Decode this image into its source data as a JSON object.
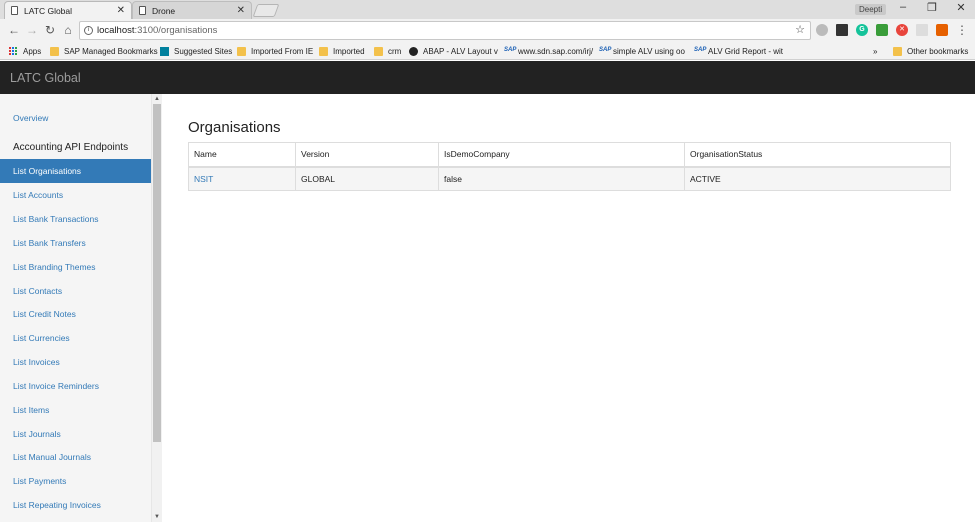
{
  "browser": {
    "tabs": [
      {
        "title": "LATC Global",
        "active": true
      },
      {
        "title": "Drone",
        "active": false
      }
    ],
    "profile_name": "Deepti",
    "address": {
      "host": "localhost",
      "path": ":3100/organisations"
    },
    "bookmarks": [
      {
        "label": "Apps",
        "icon": "apps-grid-icon"
      },
      {
        "label": "SAP Managed Bookmarks",
        "icon": "folder-icon"
      },
      {
        "label": "Suggested Sites",
        "icon": "bing-icon"
      },
      {
        "label": "Imported From IE",
        "icon": "folder-icon"
      },
      {
        "label": "Imported",
        "icon": "folder-icon"
      },
      {
        "label": "crm",
        "icon": "folder-icon"
      },
      {
        "label": "ABAP - ALV Layout v",
        "icon": "circle-icon"
      },
      {
        "label": "www.sdn.sap.com/irj/",
        "icon": "sap-icon"
      },
      {
        "label": "simple ALV using oo",
        "icon": "sap-icon"
      },
      {
        "label": "ALV Grid Report - wit",
        "icon": "sap-icon"
      }
    ],
    "overflow_label": "»",
    "other_bookmarks": "Other bookmarks"
  },
  "app": {
    "brand": "LATC Global"
  },
  "sidebar": {
    "overview": "Overview",
    "heading": "Accounting API Endpoints",
    "items": [
      "List Organisations",
      "List Accounts",
      "List Bank Transactions",
      "List Bank Transfers",
      "List Branding Themes",
      "List Contacts",
      "List Credit Notes",
      "List Currencies",
      "List Invoices",
      "List Invoice Reminders",
      "List Items",
      "List Journals",
      "List Manual Journals",
      "List Payments",
      "List Repeating Invoices"
    ],
    "active_index": 0
  },
  "main": {
    "title": "Organisations",
    "columns": [
      "Name",
      "Version",
      "IsDemoCompany",
      "OrganisationStatus"
    ],
    "rows": [
      [
        "NSIT",
        "GLOBAL",
        "false",
        "ACTIVE"
      ]
    ]
  },
  "colors": {
    "link": "#337ab7",
    "navbar": "#222222",
    "active_item": "#337ab7"
  }
}
